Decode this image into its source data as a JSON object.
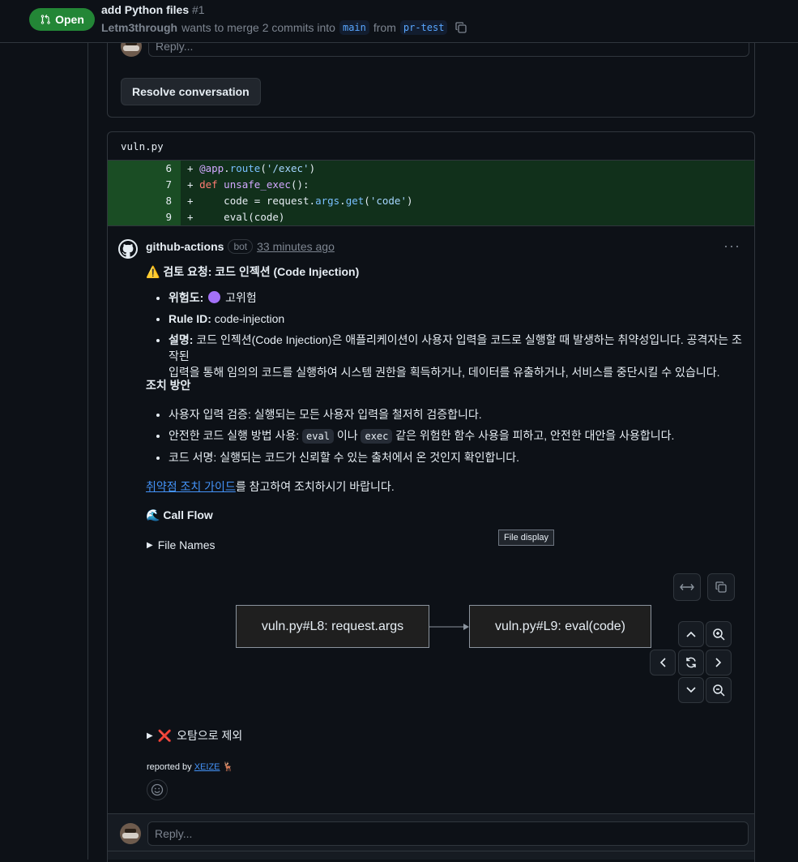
{
  "header": {
    "status": "Open",
    "title": "add Python files",
    "number": "#1",
    "author": "Letm3through",
    "merge_text": "wants to merge 2 commits into",
    "base_branch": "main",
    "from_text": "from",
    "head_branch": "pr-test"
  },
  "thread1": {
    "reply_placeholder": "Reply...",
    "resolve_label": "Resolve conversation"
  },
  "file": {
    "name": "vuln.py",
    "lines": [
      {
        "num": "6",
        "sign": "+"
      },
      {
        "num": "7",
        "sign": "+"
      },
      {
        "num": "8",
        "sign": "+"
      },
      {
        "num": "9",
        "sign": "+"
      }
    ],
    "code": {
      "l6_dec": "@app",
      "l6_dot": ".",
      "l6_attr": "route",
      "l6_open": "(",
      "l6_str": "'/exec'",
      "l6_close": ")",
      "l7_kw": "def",
      "l7_fn": "unsafe_exec",
      "l7_rest": "():",
      "l8_indent": "    code = request.",
      "l8_attr1": "args",
      "l8_dot": ".",
      "l8_attr2": "get",
      "l8_open": "(",
      "l8_str": "'code'",
      "l8_close": ")",
      "l9_indent": "    eval",
      "l9_rest": "(code)"
    }
  },
  "comment": {
    "author": "github-actions",
    "badge": "bot",
    "time": "33 minutes ago",
    "more": "···",
    "heading_emoji": "⚠️",
    "heading": "검토 요청: 코드 인젝션 (Code Injection)",
    "risk_label": "위험도:",
    "risk_value": "고위험",
    "risk_color": "#a371f7",
    "rule_label": "Rule ID:",
    "rule_value": "code-injection",
    "desc_label": "설명:",
    "desc_line1": "코드 인젝션(Code Injection)은 애플리케이션이 사용자 입력을 코드로 실행할 때 발생하는 취약성입니다. 공격자는 조작된",
    "desc_line2": "입력을 통해 임의의 코드를 실행하여 시스템 권한을 획득하거나, 데이터를 유출하거나, 서비스를 중단시킬 수 있습니다.",
    "actions_heading": "조치 방안",
    "action1": "사용자 입력 검증: 실행되는 모든 사용자 입력을 철저히 검증합니다.",
    "action2_pre": "안전한 코드 실행 방법 사용: ",
    "action2_code1": "eval",
    "action2_mid": " 이나 ",
    "action2_code2": "exec",
    "action2_post": " 같은 위험한 함수 사용을 피하고, 안전한 대안을 사용합니다.",
    "action3": "코드 서명: 실행되는 코드가 신뢰할 수 있는 출처에서 온 것인지 확인합니다.",
    "guide_link": "취약점 조치 가이드",
    "guide_rest": "를 참고하여 조치하시기 바랍니다.",
    "callflow_emoji": "🌊",
    "callflow_heading": "Call Flow",
    "file_names_summary": "File Names",
    "tooltip": "File display",
    "node1": "vuln.py#L8: request.args",
    "node2": "vuln.py#L9: eval(code)",
    "false_positive_emoji": "❌",
    "false_positive": "오탐으로 제외",
    "reported_by": "reported by",
    "reporter": "XEIZE",
    "reporter_emoji": "🦌"
  },
  "bottom": {
    "reply_placeholder": "Reply..."
  }
}
